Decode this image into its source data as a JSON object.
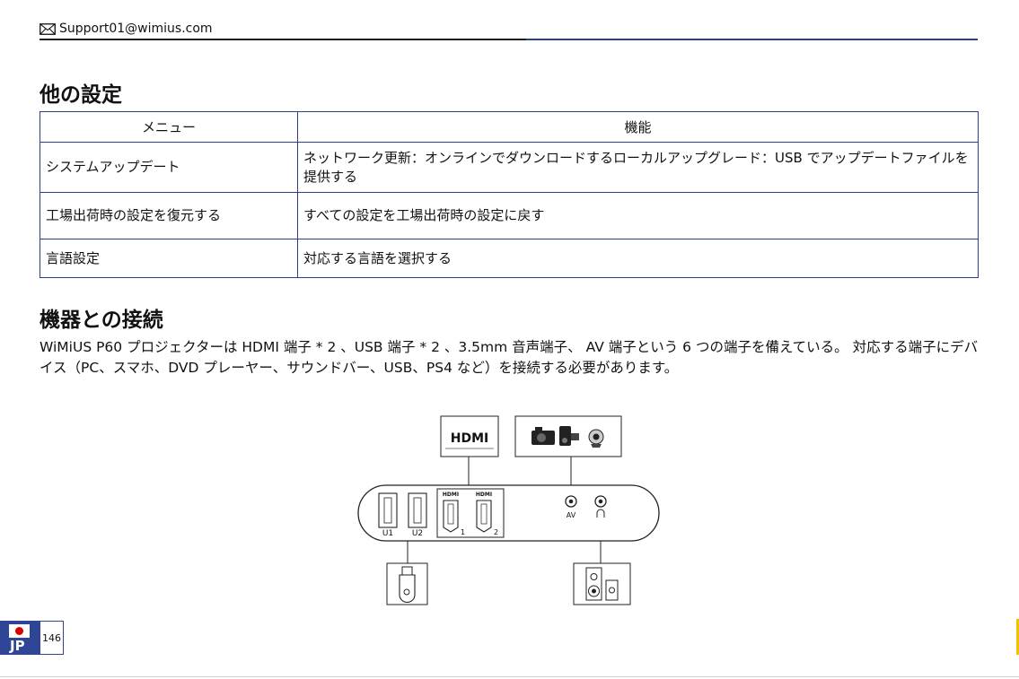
{
  "header": {
    "email": "Support01@wimius.com"
  },
  "sections": {
    "other_settings": "他の設定",
    "connection": "機器との接続"
  },
  "table": {
    "headers": [
      "メニュー",
      "機能"
    ],
    "rows": [
      [
        "システムアップデート",
        "ネットワーク更新：オンラインでダウンロードするローカルアップグレード：USB でアップデートファイルを提供する"
      ],
      [
        "工場出荷時の設定を復元する",
        "すべての設定を工場出荷時の設定に戻す"
      ],
      [
        "言語設定",
        "対応する言語を選択する"
      ]
    ]
  },
  "paragraph": "WiMiUS P60 プロジェクターは HDMI 端子 * 2 、USB 端子 * 2 、3.5mm 音声端子、 AV 端子という 6 つの端子を備えている。 対応する端子にデバイス（PC、スマホ、DVD プレーヤー、サウンドバー、USB、PS4 など）を接続する必要があります。",
  "diagram": {
    "hdmi_logo": "HDMI",
    "port_labels": {
      "u1": "U1",
      "u2": "U2",
      "hdmi1": "1",
      "hdmi2": "2",
      "av": "AV"
    }
  },
  "footer": {
    "lang_code": "JP",
    "page_number": "146"
  }
}
